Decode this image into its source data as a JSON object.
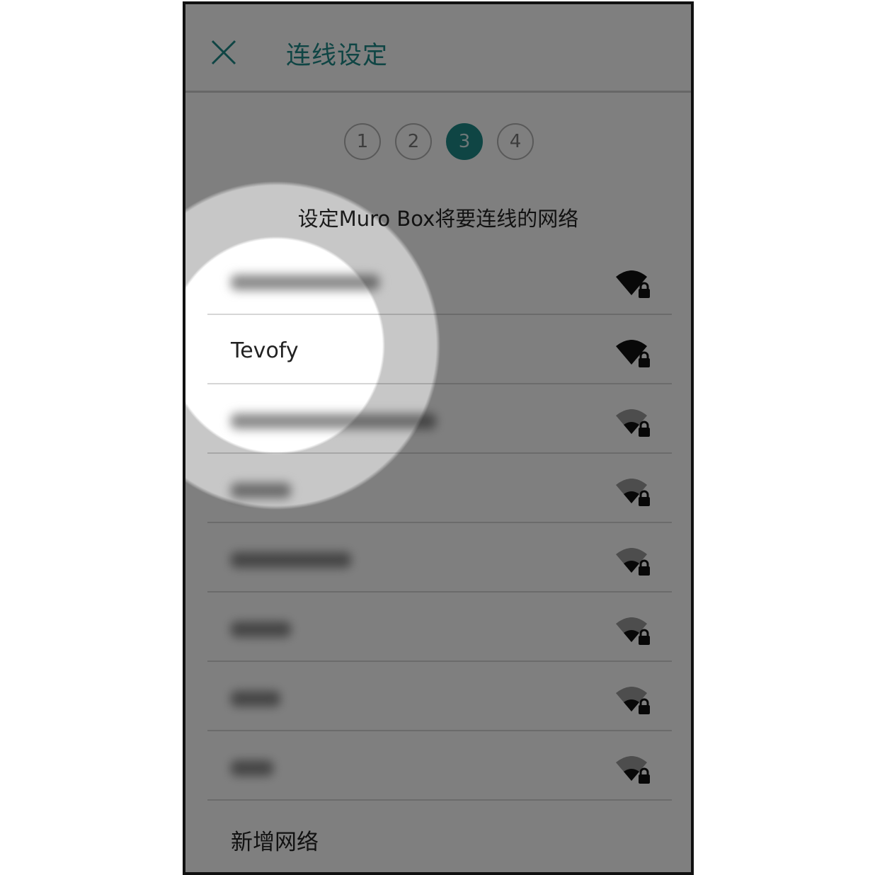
{
  "header": {
    "title": "连线设定",
    "close_icon": "close-icon"
  },
  "stepper": {
    "steps": [
      "1",
      "2",
      "3",
      "4"
    ],
    "active_step": "3"
  },
  "instruction": "设定Muro Box将要连线的网络",
  "networks": [
    {
      "ssid": "",
      "hidden": true,
      "signal": "strong",
      "locked": true
    },
    {
      "ssid": "Tevofy",
      "hidden": false,
      "signal": "strong",
      "locked": true
    },
    {
      "ssid": "",
      "hidden": true,
      "signal": "medium",
      "locked": true
    },
    {
      "ssid": "",
      "hidden": true,
      "signal": "medium",
      "locked": true
    },
    {
      "ssid": "",
      "hidden": true,
      "signal": "medium",
      "locked": true
    },
    {
      "ssid": "",
      "hidden": true,
      "signal": "medium",
      "locked": true
    },
    {
      "ssid": "",
      "hidden": true,
      "signal": "medium",
      "locked": true
    },
    {
      "ssid": "",
      "hidden": true,
      "signal": "medium",
      "locked": true
    }
  ],
  "add_network_label": "新增网络",
  "colors": {
    "accent": "#1e8a89",
    "overlay": "#000000"
  }
}
